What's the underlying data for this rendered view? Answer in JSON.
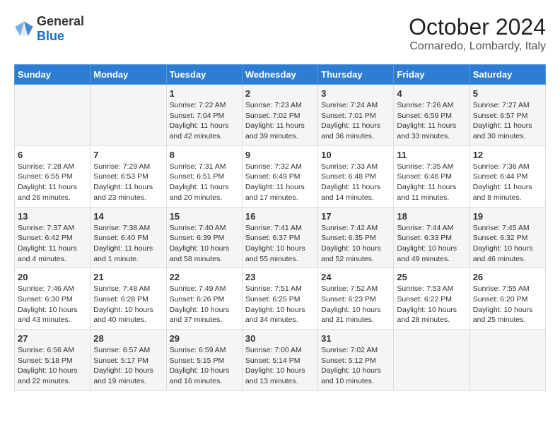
{
  "header": {
    "logo_general": "General",
    "logo_blue": "Blue",
    "month_title": "October 2024",
    "location": "Cornaredo, Lombardy, Italy"
  },
  "days_of_week": [
    "Sunday",
    "Monday",
    "Tuesday",
    "Wednesday",
    "Thursday",
    "Friday",
    "Saturday"
  ],
  "weeks": [
    [
      {
        "day": "",
        "details": ""
      },
      {
        "day": "",
        "details": ""
      },
      {
        "day": "1",
        "sunrise": "Sunrise: 7:22 AM",
        "sunset": "Sunset: 7:04 PM",
        "daylight": "Daylight: 11 hours and 42 minutes."
      },
      {
        "day": "2",
        "sunrise": "Sunrise: 7:23 AM",
        "sunset": "Sunset: 7:02 PM",
        "daylight": "Daylight: 11 hours and 39 minutes."
      },
      {
        "day": "3",
        "sunrise": "Sunrise: 7:24 AM",
        "sunset": "Sunset: 7:01 PM",
        "daylight": "Daylight: 11 hours and 36 minutes."
      },
      {
        "day": "4",
        "sunrise": "Sunrise: 7:26 AM",
        "sunset": "Sunset: 6:59 PM",
        "daylight": "Daylight: 11 hours and 33 minutes."
      },
      {
        "day": "5",
        "sunrise": "Sunrise: 7:27 AM",
        "sunset": "Sunset: 6:57 PM",
        "daylight": "Daylight: 11 hours and 30 minutes."
      }
    ],
    [
      {
        "day": "6",
        "sunrise": "Sunrise: 7:28 AM",
        "sunset": "Sunset: 6:55 PM",
        "daylight": "Daylight: 11 hours and 26 minutes."
      },
      {
        "day": "7",
        "sunrise": "Sunrise: 7:29 AM",
        "sunset": "Sunset: 6:53 PM",
        "daylight": "Daylight: 11 hours and 23 minutes."
      },
      {
        "day": "8",
        "sunrise": "Sunrise: 7:31 AM",
        "sunset": "Sunset: 6:51 PM",
        "daylight": "Daylight: 11 hours and 20 minutes."
      },
      {
        "day": "9",
        "sunrise": "Sunrise: 7:32 AM",
        "sunset": "Sunset: 6:49 PM",
        "daylight": "Daylight: 11 hours and 17 minutes."
      },
      {
        "day": "10",
        "sunrise": "Sunrise: 7:33 AM",
        "sunset": "Sunset: 6:48 PM",
        "daylight": "Daylight: 11 hours and 14 minutes."
      },
      {
        "day": "11",
        "sunrise": "Sunrise: 7:35 AM",
        "sunset": "Sunset: 6:46 PM",
        "daylight": "Daylight: 11 hours and 11 minutes."
      },
      {
        "day": "12",
        "sunrise": "Sunrise: 7:36 AM",
        "sunset": "Sunset: 6:44 PM",
        "daylight": "Daylight: 11 hours and 8 minutes."
      }
    ],
    [
      {
        "day": "13",
        "sunrise": "Sunrise: 7:37 AM",
        "sunset": "Sunset: 6:42 PM",
        "daylight": "Daylight: 11 hours and 4 minutes."
      },
      {
        "day": "14",
        "sunrise": "Sunrise: 7:38 AM",
        "sunset": "Sunset: 6:40 PM",
        "daylight": "Daylight: 11 hours and 1 minute."
      },
      {
        "day": "15",
        "sunrise": "Sunrise: 7:40 AM",
        "sunset": "Sunset: 6:39 PM",
        "daylight": "Daylight: 10 hours and 58 minutes."
      },
      {
        "day": "16",
        "sunrise": "Sunrise: 7:41 AM",
        "sunset": "Sunset: 6:37 PM",
        "daylight": "Daylight: 10 hours and 55 minutes."
      },
      {
        "day": "17",
        "sunrise": "Sunrise: 7:42 AM",
        "sunset": "Sunset: 6:35 PM",
        "daylight": "Daylight: 10 hours and 52 minutes."
      },
      {
        "day": "18",
        "sunrise": "Sunrise: 7:44 AM",
        "sunset": "Sunset: 6:33 PM",
        "daylight": "Daylight: 10 hours and 49 minutes."
      },
      {
        "day": "19",
        "sunrise": "Sunrise: 7:45 AM",
        "sunset": "Sunset: 6:32 PM",
        "daylight": "Daylight: 10 hours and 46 minutes."
      }
    ],
    [
      {
        "day": "20",
        "sunrise": "Sunrise: 7:46 AM",
        "sunset": "Sunset: 6:30 PM",
        "daylight": "Daylight: 10 hours and 43 minutes."
      },
      {
        "day": "21",
        "sunrise": "Sunrise: 7:48 AM",
        "sunset": "Sunset: 6:28 PM",
        "daylight": "Daylight: 10 hours and 40 minutes."
      },
      {
        "day": "22",
        "sunrise": "Sunrise: 7:49 AM",
        "sunset": "Sunset: 6:26 PM",
        "daylight": "Daylight: 10 hours and 37 minutes."
      },
      {
        "day": "23",
        "sunrise": "Sunrise: 7:51 AM",
        "sunset": "Sunset: 6:25 PM",
        "daylight": "Daylight: 10 hours and 34 minutes."
      },
      {
        "day": "24",
        "sunrise": "Sunrise: 7:52 AM",
        "sunset": "Sunset: 6:23 PM",
        "daylight": "Daylight: 10 hours and 31 minutes."
      },
      {
        "day": "25",
        "sunrise": "Sunrise: 7:53 AM",
        "sunset": "Sunset: 6:22 PM",
        "daylight": "Daylight: 10 hours and 28 minutes."
      },
      {
        "day": "26",
        "sunrise": "Sunrise: 7:55 AM",
        "sunset": "Sunset: 6:20 PM",
        "daylight": "Daylight: 10 hours and 25 minutes."
      }
    ],
    [
      {
        "day": "27",
        "sunrise": "Sunrise: 6:56 AM",
        "sunset": "Sunset: 5:18 PM",
        "daylight": "Daylight: 10 hours and 22 minutes."
      },
      {
        "day": "28",
        "sunrise": "Sunrise: 6:57 AM",
        "sunset": "Sunset: 5:17 PM",
        "daylight": "Daylight: 10 hours and 19 minutes."
      },
      {
        "day": "29",
        "sunrise": "Sunrise: 6:59 AM",
        "sunset": "Sunset: 5:15 PM",
        "daylight": "Daylight: 10 hours and 16 minutes."
      },
      {
        "day": "30",
        "sunrise": "Sunrise: 7:00 AM",
        "sunset": "Sunset: 5:14 PM",
        "daylight": "Daylight: 10 hours and 13 minutes."
      },
      {
        "day": "31",
        "sunrise": "Sunrise: 7:02 AM",
        "sunset": "Sunset: 5:12 PM",
        "daylight": "Daylight: 10 hours and 10 minutes."
      },
      {
        "day": "",
        "details": ""
      },
      {
        "day": "",
        "details": ""
      }
    ]
  ]
}
